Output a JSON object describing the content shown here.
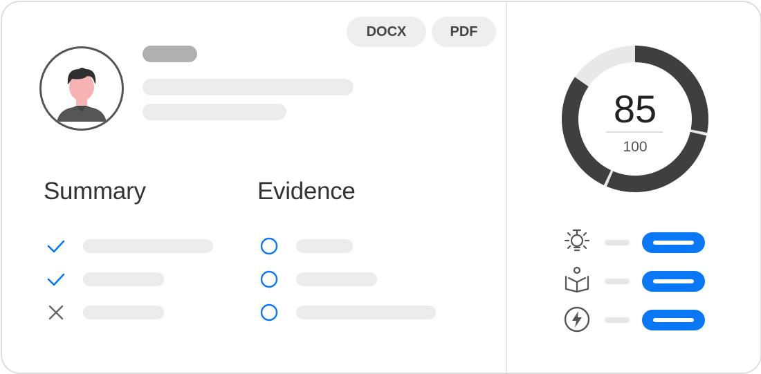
{
  "export": {
    "docx_label": "DOCX",
    "pdf_label": "PDF"
  },
  "sections": {
    "summary_title": "Summary",
    "evidence_title": "Evidence"
  },
  "summary_items": [
    {
      "status": "check"
    },
    {
      "status": "check"
    },
    {
      "status": "cross"
    }
  ],
  "evidence_items": [
    {
      "status": "open"
    },
    {
      "status": "open"
    },
    {
      "status": "open"
    }
  ],
  "score": {
    "value": "85",
    "max": "100",
    "fraction": 0.85
  },
  "metrics": [
    {
      "icon": "lightbulb-icon"
    },
    {
      "icon": "reading-person-icon"
    },
    {
      "icon": "lightning-icon"
    }
  ],
  "colors": {
    "accent": "#0a78f5",
    "ring": "#3f3f3f",
    "ring_track": "#e8e8e8",
    "skeleton": "#ebebeb",
    "skeleton_dark": "#b0b0b0"
  }
}
